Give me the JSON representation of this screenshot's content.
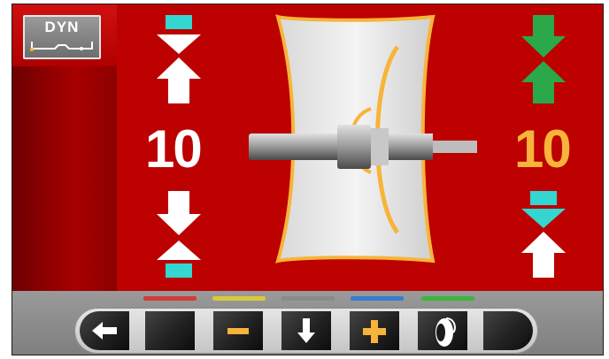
{
  "mode_button": {
    "label": "DYN",
    "icon": "rim-profile-icon"
  },
  "left_plane": {
    "value": "10",
    "color": "#ffffff",
    "marker_color": "#33d6d0"
  },
  "right_plane": {
    "value": "10",
    "color": "#f7b43a",
    "marker_color_top": "#2aa84a",
    "marker_color_bottom": "#33d6d0"
  },
  "indicators": [
    "#d23b3b",
    "#d8c83a",
    "#8a8a8a",
    "#3a7bd0",
    "#3fb53f"
  ],
  "toolbar": {
    "keys": [
      {
        "name": "back-key",
        "icon": "arrow-left-icon"
      },
      {
        "name": "f1-key",
        "icon": ""
      },
      {
        "name": "minus-key",
        "icon": "minus-icon"
      },
      {
        "name": "down-key",
        "icon": "arrow-down-icon"
      },
      {
        "name": "plus-key",
        "icon": "plus-icon"
      },
      {
        "name": "wheel-key",
        "icon": "wheel-icon"
      },
      {
        "name": "f6-key",
        "icon": ""
      }
    ]
  }
}
